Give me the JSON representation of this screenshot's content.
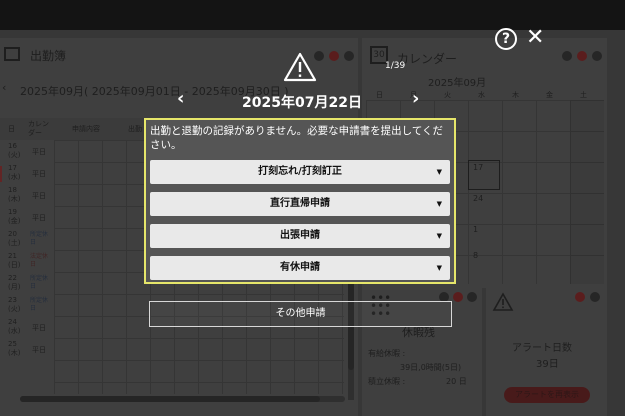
{
  "left_panel": {
    "title": "出勤簿",
    "month_range": "2025年09月( 2025年09月01日 - 2025年09月30日 )",
    "columns": [
      "日",
      "カレンダー",
      "申請内容",
      "出勤"
    ],
    "rows": [
      {
        "date": "16",
        "dow": "(火)",
        "cal": "平日"
      },
      {
        "date": "17",
        "dow": "(水)",
        "cal": "平日"
      },
      {
        "date": "18",
        "dow": "(木)",
        "cal": "平日"
      },
      {
        "date": "19",
        "dow": "(金)",
        "cal": "平日"
      },
      {
        "date": "20",
        "dow": "(土)",
        "cal": "所定休日"
      },
      {
        "date": "21",
        "dow": "(日)",
        "cal": "法定休日"
      },
      {
        "date": "22",
        "dow": "(月)",
        "cal": "所定休日"
      },
      {
        "date": "23",
        "dow": "(火)",
        "cal": "所定休日"
      },
      {
        "date": "24",
        "dow": "(水)",
        "cal": "平日"
      },
      {
        "date": "25",
        "dow": "(木)",
        "cal": "平日"
      }
    ]
  },
  "calendar_panel": {
    "title": "カレンダー",
    "month": "2025年09月",
    "weekdays": [
      "日",
      "月",
      "火",
      "水",
      "木",
      "金",
      "土"
    ],
    "visible_days": [
      "17",
      "24",
      "1",
      "8"
    ]
  },
  "leave_panel": {
    "title": "休暇残",
    "paid_label": "有給休暇 :",
    "paid_value": "39日,0時間(5日)",
    "accum_label": "積立休暇 :",
    "accum_value": "20 日"
  },
  "alert_panel": {
    "label": "アラート日数",
    "value": "39日",
    "button": "アラートを再表示"
  },
  "dialog": {
    "pager": "1/39",
    "date": "2025年07月22日",
    "message": "出勤と退勤の記録がありません。必要な申請書を提出してください。",
    "buttons": [
      "打刻忘れ/打刻訂正",
      "直行直帰申請",
      "出張申請",
      "有休申請"
    ],
    "other": "その他申請"
  }
}
